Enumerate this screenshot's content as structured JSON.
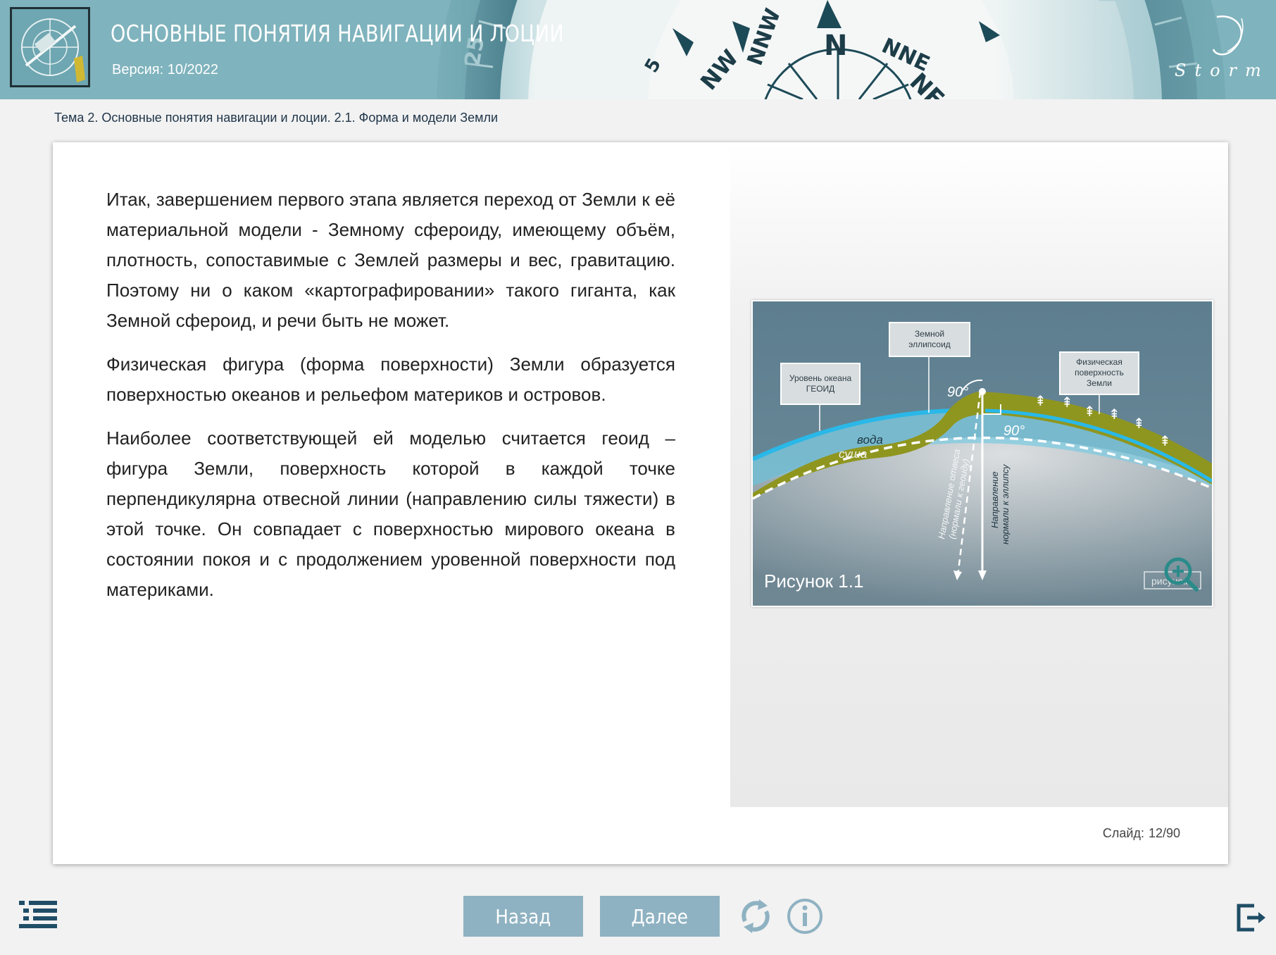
{
  "header": {
    "title": "ОСНОВНЫЕ ПОНЯТИЯ НАВИГАЦИИ И ЛОЦИИ",
    "version": "Версия: 10/2022",
    "brand": "Storm",
    "compass_labels": [
      "N",
      "NNE",
      "NE",
      "NNW",
      "NW",
      "5",
      "25"
    ]
  },
  "breadcrumb": "Тема 2. Основные понятия навигации и лоции. 2.1. Форма и модели Земли",
  "content": {
    "paragraphs": [
      "Итак, завершением первого этапа является переход от Земли к её материальной модели - Земному сфероиду, имеющему объём, плотность, сопоставимые с Землей размеры и вес, гравитацию. Поэтому ни о каком «картографировании» такого гиганта, как Земной сфероид, и речи быть не может.",
      "Физическая фигура (форма поверхности) Земли образуется поверхностью океанов и рельефом материков и островов.",
      "Наиболее соответствующей ей моделью считается геоид – фигура Земли, поверхность которой в каждой точке перпендикулярна отвесной линии (направлению силы тяжести) в этой точке. Он совпадает с поверхностью мирового океана в состоянии покоя и с продолжением уровенной поверхности под материками."
    ]
  },
  "figure": {
    "caption": "Рисунок 1.1",
    "zoom_label": "рисунок",
    "labels": {
      "ellipsoid_line1": "Земной",
      "ellipsoid_line2": "эллипсоид",
      "geoid_line1": "Уровень океана",
      "geoid_line2": "ГЕОИД",
      "surface_line1": "Физическая",
      "surface_line2": "поверхность",
      "surface_line3": "Земли",
      "angle1": "90°",
      "angle2": "90°",
      "water": "вода",
      "land": "суша",
      "plumb_line1": "Направление отвеса",
      "plumb_line2": "(нормали к геоиду)",
      "normal_line1": "Направление",
      "normal_line2": "нормали к эллипсу"
    }
  },
  "slide_counter": {
    "label": "Слайд:",
    "value": "12/90"
  },
  "footer": {
    "back_label": "Назад",
    "next_label": "Далее"
  }
}
